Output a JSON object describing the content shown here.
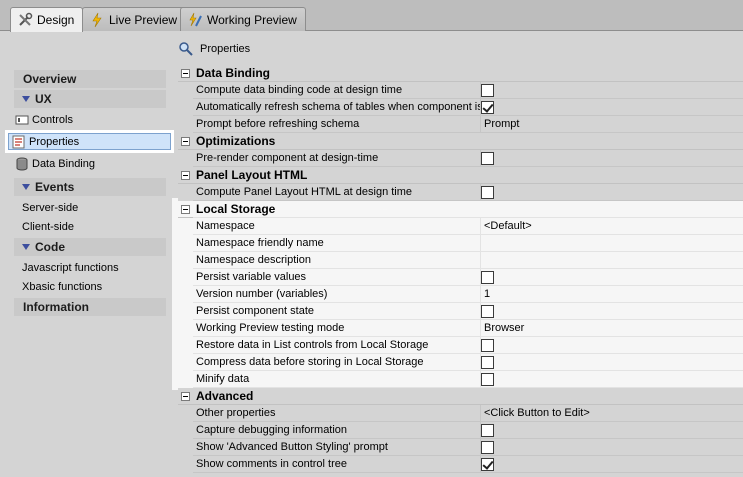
{
  "tabs": [
    {
      "label": "Design",
      "icon": "tools-icon"
    },
    {
      "label": "Live Preview",
      "icon": "lightning-icon"
    },
    {
      "label": "Working Preview",
      "icon": "lightning-pencil-icon"
    }
  ],
  "title": {
    "label": "Properties",
    "icon": "magnifier-icon"
  },
  "nav": {
    "overview": "Overview",
    "ux": "UX",
    "controls": "Controls",
    "properties": "Properties",
    "data_binding": "Data Binding",
    "events": "Events",
    "server_side": "Server-side",
    "client_side": "Client-side",
    "code": "Code",
    "javascript_functions": "Javascript functions",
    "xbasic_functions": "Xbasic functions",
    "information": "Information"
  },
  "groups": {
    "data_binding": {
      "title": "Data Binding",
      "props": [
        {
          "name": "Compute data binding code at design time",
          "type": "checkbox",
          "checked": false
        },
        {
          "name": "Automatically refresh schema of tables when component is o",
          "type": "checkbox",
          "checked": true
        },
        {
          "name": "Prompt before refreshing schema",
          "type": "text",
          "value": "Prompt"
        }
      ]
    },
    "optimizations": {
      "title": "Optimizations",
      "props": [
        {
          "name": "Pre-render component at design-time",
          "type": "checkbox",
          "checked": false
        }
      ]
    },
    "panel_layout": {
      "title": "Panel Layout HTML",
      "props": [
        {
          "name": "Compute Panel Layout HTML at design time",
          "type": "checkbox",
          "checked": false
        }
      ]
    },
    "local_storage": {
      "title": "Local Storage",
      "props": [
        {
          "name": "Namespace",
          "type": "text",
          "value": "<Default>"
        },
        {
          "name": "Namespace friendly name",
          "type": "text",
          "value": ""
        },
        {
          "name": "Namespace description",
          "type": "text",
          "value": ""
        },
        {
          "name": "Persist variable values",
          "type": "checkbox",
          "checked": false
        },
        {
          "name": "Version number (variables)",
          "type": "text",
          "value": "1"
        },
        {
          "name": "Persist component state",
          "type": "checkbox",
          "checked": false
        },
        {
          "name": "Working Preview testing mode",
          "type": "text",
          "value": "Browser"
        },
        {
          "name": "Restore data in List controls from Local Storage",
          "type": "checkbox",
          "checked": false
        },
        {
          "name": "Compress data before storing in Local Storage",
          "type": "checkbox",
          "checked": false
        },
        {
          "name": "Minify data",
          "type": "checkbox",
          "checked": false
        }
      ]
    },
    "advanced": {
      "title": "Advanced",
      "props": [
        {
          "name": "Other properties",
          "type": "text",
          "value": "<Click Button to Edit>"
        },
        {
          "name": "Capture debugging information",
          "type": "checkbox",
          "checked": false
        },
        {
          "name": "Show 'Advanced Button Styling' prompt",
          "type": "checkbox",
          "checked": false
        },
        {
          "name": "Show comments in control tree",
          "type": "checkbox",
          "checked": true
        }
      ]
    }
  }
}
